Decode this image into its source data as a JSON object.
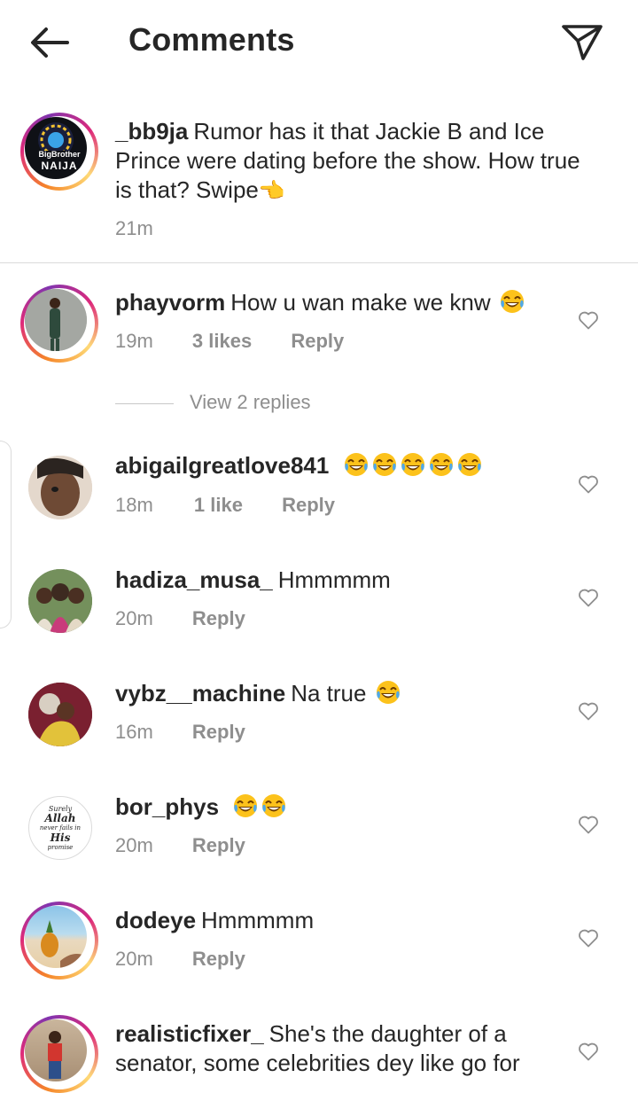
{
  "header": {
    "title": "Comments"
  },
  "caption": {
    "username": "_bb9ja",
    "text": "Rumor has it that Jackie B and Ice Prince were dating before the show.  How true is that? Swipe",
    "emoji": "👈",
    "time": "21m",
    "avatar_text_top": "BigBrother",
    "avatar_text_bottom": "NAIJA"
  },
  "comments": [
    {
      "username": "phayvorm",
      "text": "How u wan make we knw",
      "emoji_count": 1,
      "time": "19m",
      "likes": "3 likes",
      "reply": "Reply"
    },
    {
      "username": "abigailgreatlove841",
      "text": "",
      "emoji_count": 5,
      "time": "18m",
      "likes": "1 like",
      "reply": "Reply"
    },
    {
      "username": "hadiza_musa_",
      "text": "Hmmmmm",
      "emoji_count": 0,
      "time": "20m",
      "likes": "",
      "reply": "Reply"
    },
    {
      "username": "vybz__machine",
      "text": "Na true",
      "emoji_count": 1,
      "time": "16m",
      "likes": "",
      "reply": "Reply"
    },
    {
      "username": "bor_phys",
      "text": "",
      "emoji_count": 2,
      "time": "20m",
      "likes": "",
      "reply": "Reply"
    },
    {
      "username": "dodeye",
      "text": "Hmmmmm",
      "emoji_count": 0,
      "time": "20m",
      "likes": "",
      "reply": "Reply"
    },
    {
      "username": "realisticfixer_",
      "text": "She's the daughter of a senator, some celebrities dey like go for",
      "emoji_count": 0,
      "time": "",
      "likes": "",
      "reply": ""
    }
  ],
  "view_replies": "View 2 replies",
  "bor_phys_avatar": {
    "line1": "Surely",
    "line2": "Allah",
    "line3": "never fails in",
    "line4": "His",
    "line5": "promise"
  },
  "colors": {
    "text": "#262626",
    "muted": "#8e8e8e",
    "divider": "#dbdbdb",
    "story_ring_start": "#f58529",
    "story_ring_end": "#dd2a7b"
  },
  "icons": {
    "back": "arrow-left-icon",
    "send": "paper-plane-icon",
    "like": "heart-outline-icon",
    "emoji": "face-with-tears-of-joy-icon"
  }
}
